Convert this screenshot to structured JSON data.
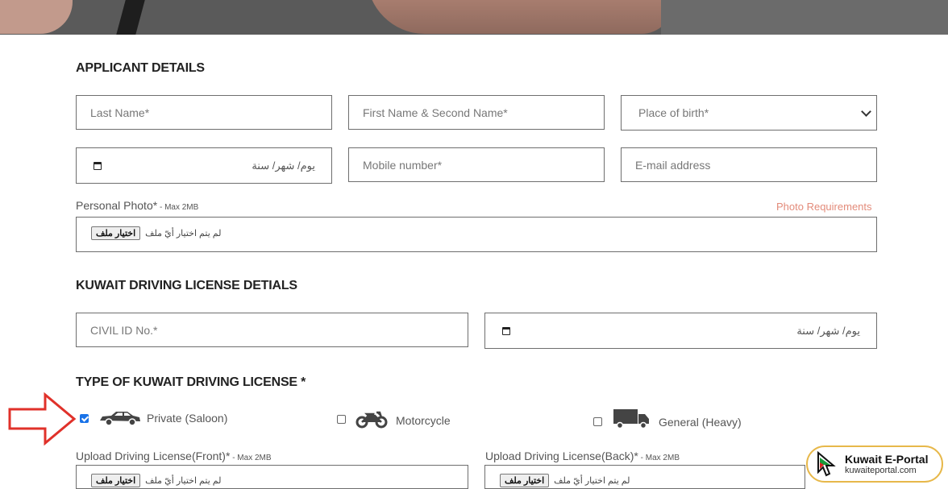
{
  "applicant": {
    "heading": "APPLICANT DETAILS",
    "last_name_placeholder": "Last Name*",
    "first_name_placeholder": "First Name & Second Name*",
    "place_of_birth": "Place of birth*",
    "date_text": "يوم/ شهر/ سنة",
    "mobile_placeholder": "Mobile number*",
    "email_placeholder": "E-mail address",
    "photo_label": "Personal Photo*",
    "photo_max": " - Max 2MB",
    "photo_requirements": "Photo Requirements",
    "file_button": "اختيار ملف",
    "file_none": "لم يتم اختيار أيّ ملف"
  },
  "license": {
    "heading": "KUWAIT DRIVING LICENSE DETIALS",
    "civil_id_placeholder": "CIVIL ID No.*",
    "date_text": "يوم/ شهر/ سنة"
  },
  "type": {
    "heading": "TYPE OF KUWAIT DRIVING LICENSE *",
    "options": [
      {
        "label": "Private (Saloon)",
        "checked": true,
        "icon": "car-icon"
      },
      {
        "label": "Motorcycle",
        "checked": false,
        "icon": "motorcycle-icon"
      },
      {
        "label": "General (Heavy)",
        "checked": false,
        "icon": "truck-icon"
      }
    ],
    "upload_front_label": "Upload Driving License(Front)*",
    "upload_back_label": "Upload Driving License(Back)*",
    "max": " - Max 2MB",
    "file_button": "اختيار ملف",
    "file_none": "لم يتم اختيار أيّ ملف"
  },
  "watermark": {
    "title": "Kuwait E-Portal",
    "url": "kuwaiteportal.com"
  },
  "colors": {
    "accent_link": "#e38b7a",
    "arrow": "#e0312a",
    "checkbox": "#1a73e8"
  }
}
